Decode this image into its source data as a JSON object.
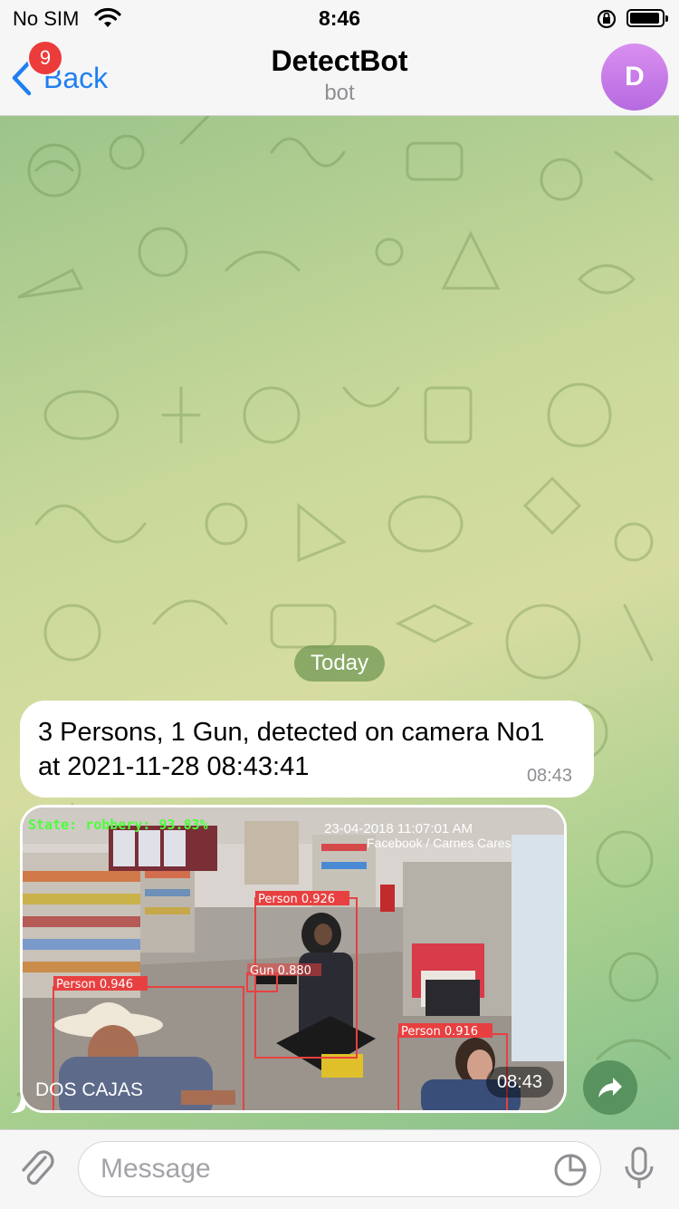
{
  "status_bar": {
    "carrier": "No SIM",
    "time": "8:46"
  },
  "header": {
    "back_label": "Back",
    "unread_badge": "9",
    "title": "DetectBot",
    "subtitle": "bot",
    "avatar_letter": "D"
  },
  "chat": {
    "date_label": "Today",
    "text_message": {
      "text": "3 Persons, 1 Gun,  detected on camera No1  at 2021-11-28 08:43:41",
      "time": "08:43"
    },
    "photo_message": {
      "time": "08:43",
      "overlay_state": "State: robbery: 93.83%",
      "overlay_timestamp": "23-04-2018 11:07:01 AM",
      "overlay_source": "Facebook / Carnes Cares",
      "overlay_store": "DOS CAJAS",
      "detections": [
        {
          "label": "Person 0.926"
        },
        {
          "label": "Gun 0.880"
        },
        {
          "label": "Person 0.946"
        },
        {
          "label": "Person 0.916"
        }
      ]
    }
  },
  "input": {
    "placeholder": "Message"
  },
  "colors": {
    "accent": "#1f7ff0",
    "badge": "#ec3b3b",
    "detection_box": "#e84040",
    "state_text": "#4cff3a"
  }
}
